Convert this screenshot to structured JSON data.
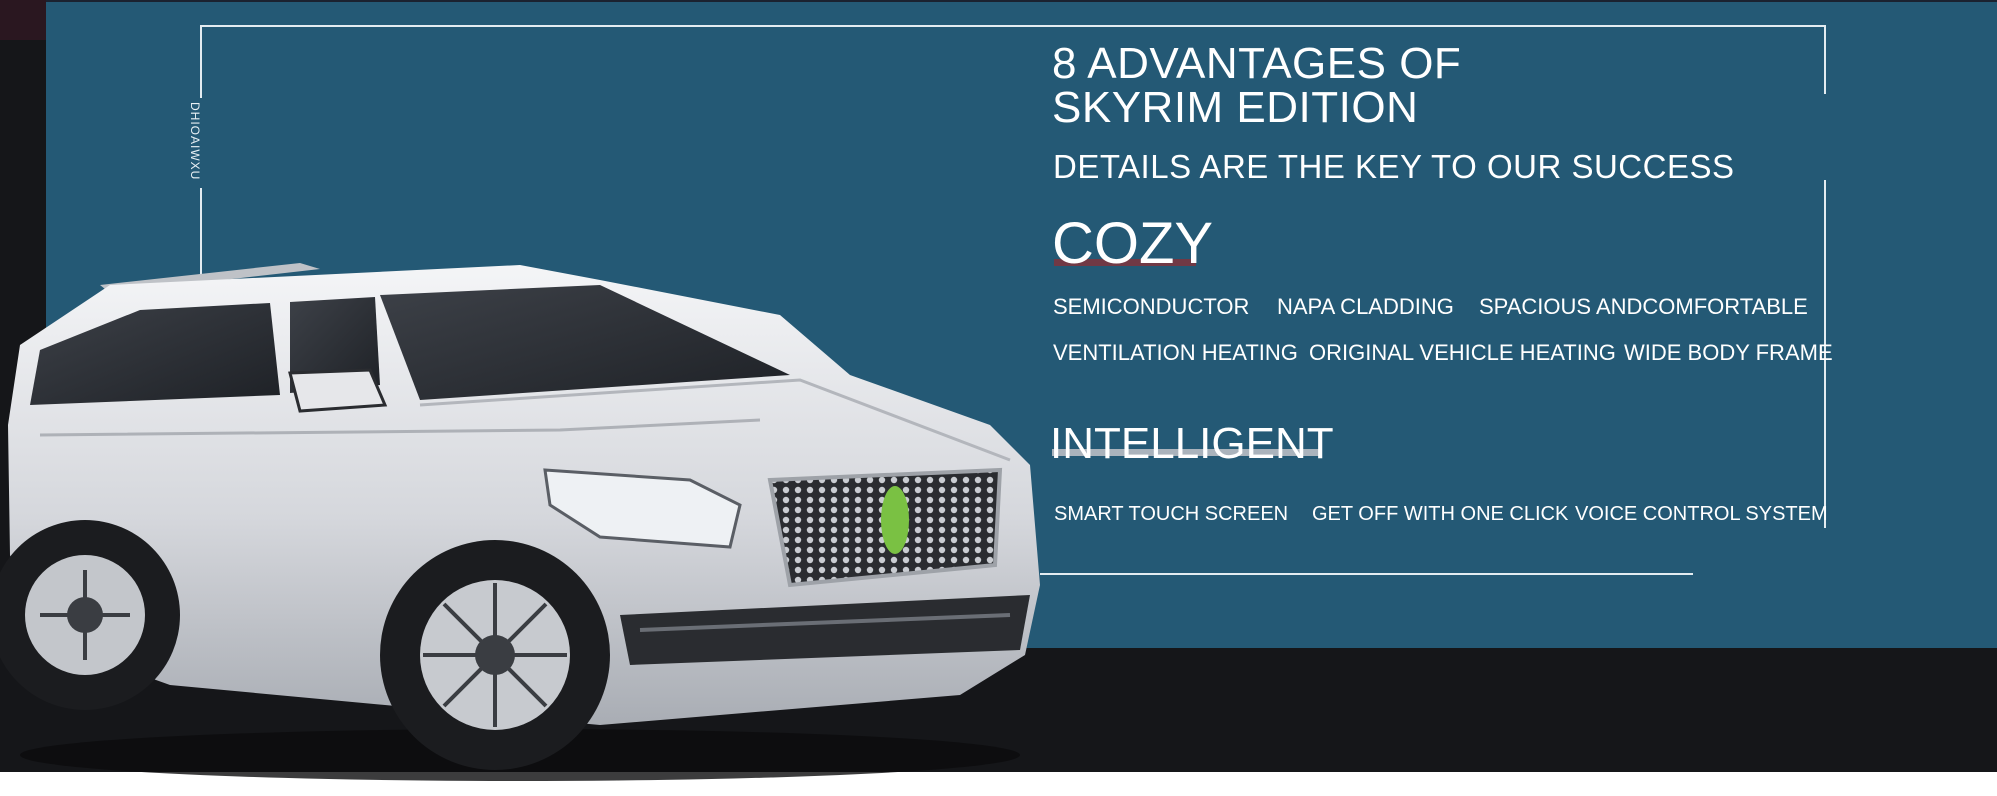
{
  "vertical_label": "DHIOAIWXU",
  "headline": {
    "line1": "8 ADVANTAGES OF",
    "line2": "SKYRIM EDITION"
  },
  "tagline": "DETAILS ARE THE KEY TO OUR SUCCESS",
  "sections": {
    "cozy": {
      "heading": "COZY",
      "underline_color": "#7a3540",
      "row1": [
        "SEMICONDUCTOR",
        "NAPA CLADDING",
        "SPACIOUS ANDCOMFORTABLE"
      ],
      "row2": [
        "VENTILATION HEATING",
        "ORIGINAL VEHICLE HEATING",
        "WIDE BODY FRAME"
      ]
    },
    "intelligent": {
      "heading": "INTELLIGENT",
      "underline_color": "#b9bdc4",
      "row1": [
        "SMART TOUCH SCREEN",
        "GET OFF WITH ONE CLICK",
        "VOICE CONTROL SYSTEM"
      ]
    }
  },
  "colors": {
    "panel_blue": "#245975",
    "dark_band": "#151619",
    "frame_line": "#e3ecf1",
    "text": "#ffffff",
    "car_body": "#d9dbdf",
    "grille_emblem": "#7ac143"
  },
  "image": {
    "subject": "silver-full-size-suv",
    "icon": "suv-car-image"
  }
}
